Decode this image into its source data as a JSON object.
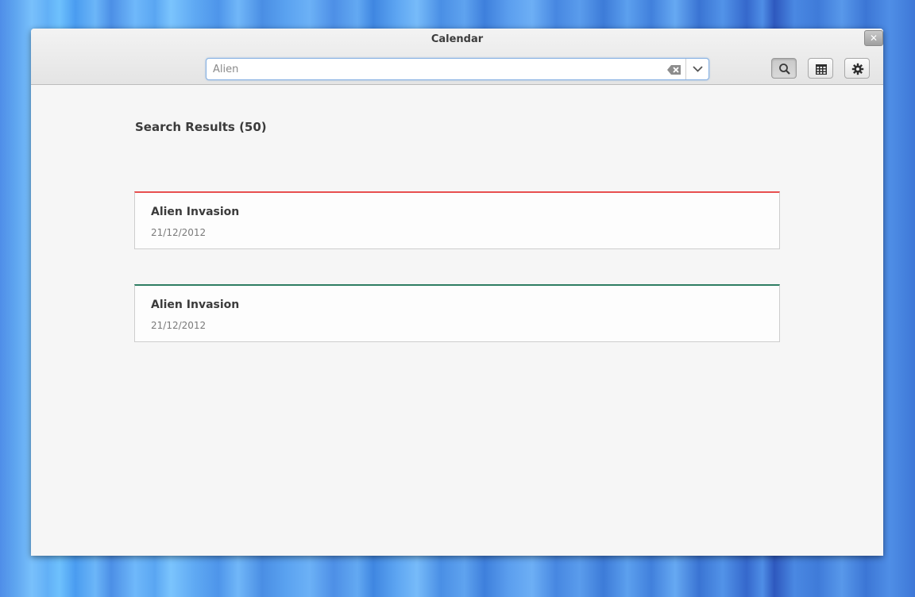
{
  "window": {
    "title": "Calendar",
    "close_glyph": "✕"
  },
  "search": {
    "value": "Alien",
    "placeholder": "Alien",
    "clear_icon": "edit-clear-icon",
    "dropdown_icon": "chevron-down-icon"
  },
  "toolbar": {
    "search_icon": "search-icon",
    "calendar_icon": "calendar-grid-icon",
    "settings_icon": "gear-icon"
  },
  "results": {
    "heading": "Search Results (50)",
    "items": [
      {
        "title": "Alien Invasion",
        "date": "21/12/2012",
        "color": "#e85050"
      },
      {
        "title": "Alien Invasion",
        "date": "21/12/2012",
        "color": "#2e7d62"
      }
    ]
  }
}
